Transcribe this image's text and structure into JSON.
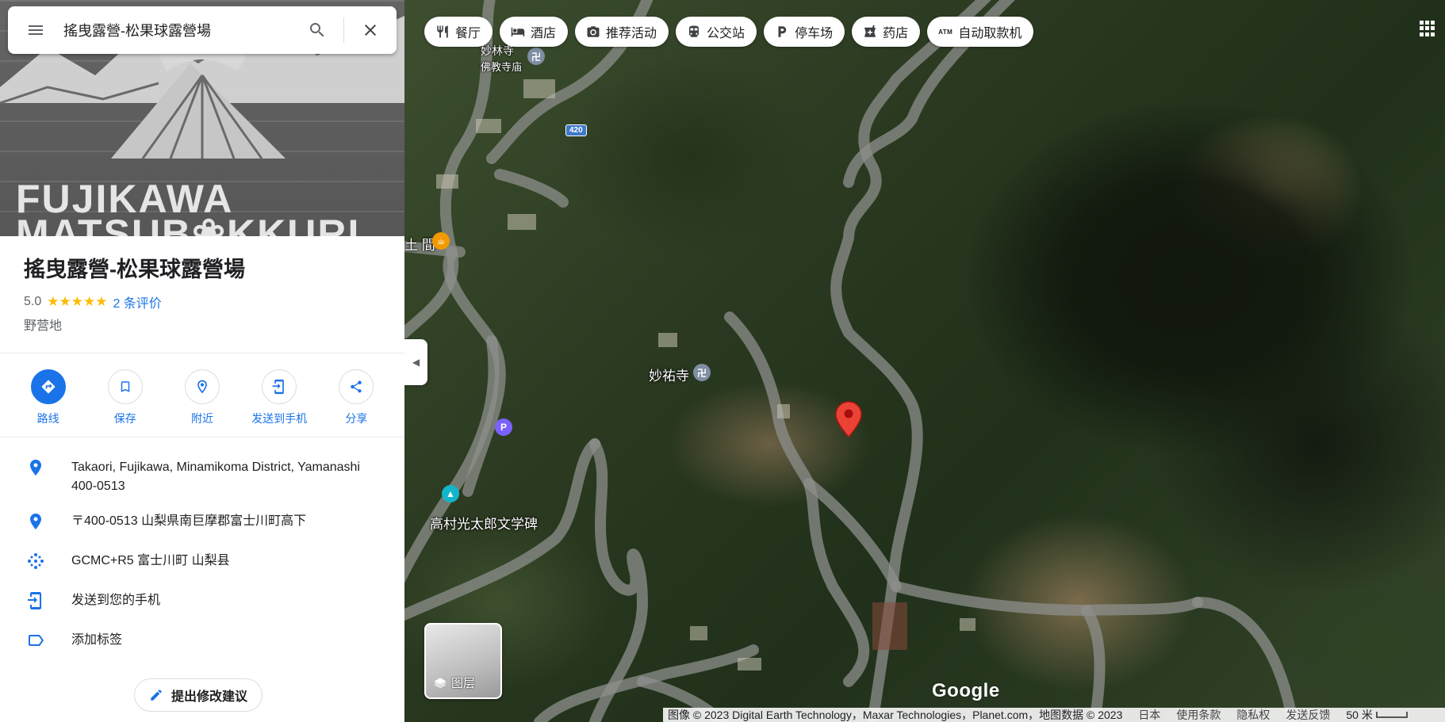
{
  "search": {
    "query": "搖曳露營-松果球露營場"
  },
  "hero": {
    "logo_line1": "FUJIKAWA",
    "logo_line2": "MATSUB❀KKURI"
  },
  "place": {
    "name": "搖曳露營-松果球露營場",
    "rating": "5.0",
    "stars": "★★★★★",
    "reviews": "2 条评价",
    "category": "野营地"
  },
  "actions": [
    {
      "label": "路线",
      "icon": "directions-icon"
    },
    {
      "label": "保存",
      "icon": "bookmark-icon"
    },
    {
      "label": "附近",
      "icon": "nearby-icon"
    },
    {
      "label": "发送到手机",
      "icon": "send-to-phone-icon"
    },
    {
      "label": "分享",
      "icon": "share-icon"
    }
  ],
  "details": {
    "address_en": "Takaori, Fujikawa, Minamikoma District, Yamanashi 400-0513",
    "address_jp": "〒400-0513 山梨県南巨摩郡富士川町高下",
    "plus_code": "GCMC+R5 富士川町 山梨县",
    "send_phone": "发送到您的手机",
    "add_label": "添加标签"
  },
  "suggest_edit": "提出修改建议",
  "chips": [
    {
      "label": "餐厅",
      "icon": "restaurant-icon"
    },
    {
      "label": "酒店",
      "icon": "hotel-icon"
    },
    {
      "label": "推荐活动",
      "icon": "camera-icon"
    },
    {
      "label": "公交站",
      "icon": "transit-icon"
    },
    {
      "label": "停车场",
      "icon": "parking-icon"
    },
    {
      "label": "药店",
      "icon": "pharmacy-icon"
    },
    {
      "label": "自动取款机",
      "icon": "atm-icon",
      "badge": "ATM"
    }
  ],
  "map": {
    "labels": {
      "temple1_name": "妙林寺",
      "temple1_sub": "佛教寺庙",
      "road_number": "420",
      "place_partial": "土 間",
      "temple2": "妙祐寺",
      "monument": "高村光太郎文学碑"
    },
    "layers_label": "图层",
    "google": "Google"
  },
  "footer": {
    "attribution": "图像 © 2023 Digital Earth Technology，Maxar Technologies，Planet.com，地图数据 © 2023",
    "region": "日本",
    "terms": "使用条款",
    "privacy": "隐私权",
    "feedback": "发送反馈",
    "scale": "50 米"
  },
  "colors": {
    "accent": "#1a73e8",
    "pin": "#ea4335",
    "star": "#fbbc04"
  }
}
